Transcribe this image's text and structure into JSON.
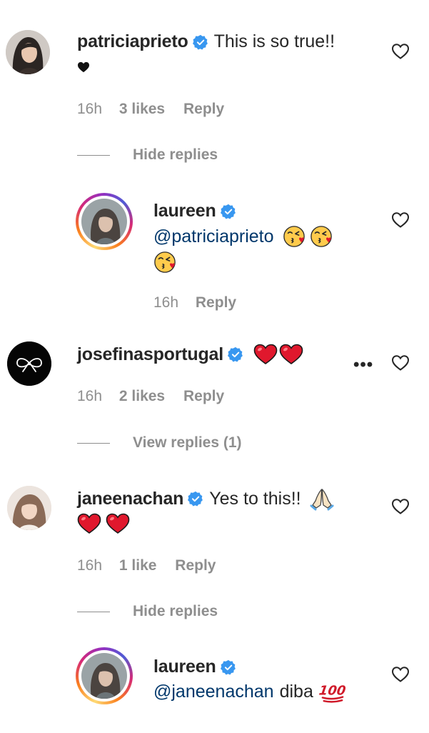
{
  "comments": [
    {
      "username": "patriciaprieto",
      "text": "This is so true!!",
      "time": "16h",
      "likes": "3 likes",
      "reply": "Reply",
      "replies_toggle": "Hide replies",
      "avatar_icon": "profile-photo",
      "replies": [
        {
          "username": "laureen",
          "mention": "@patriciaprieto",
          "time": "16h",
          "reply": "Reply",
          "emojis": [
            "kissing-face-emoji",
            "kissing-face-emoji",
            "kissing-face-emoji"
          ]
        }
      ]
    },
    {
      "username": "josefinasportugal",
      "time": "16h",
      "likes": "2 likes",
      "reply": "Reply",
      "more": "•••",
      "replies_toggle": "View replies (1)",
      "avatar_icon": "bow-logo",
      "emojis": [
        "red-heart-emoji",
        "red-heart-emoji"
      ]
    },
    {
      "username": "janeenachan",
      "text": "Yes to this!!",
      "time": "16h",
      "likes": "1 like",
      "reply": "Reply",
      "replies_toggle": "Hide replies",
      "emojis": [
        "folded-hands-emoji",
        "red-heart-emoji",
        "red-heart-emoji"
      ],
      "replies": [
        {
          "username": "laureen",
          "mention": "@janeenachan",
          "text": "diba",
          "emojis": [
            "hundred-points-emoji"
          ]
        }
      ]
    }
  ],
  "colors": {
    "text": "#262626",
    "secondary": "#8e8e8e",
    "mention": "#00376b",
    "verified": "#3897f0",
    "heart": "#e0182d"
  }
}
